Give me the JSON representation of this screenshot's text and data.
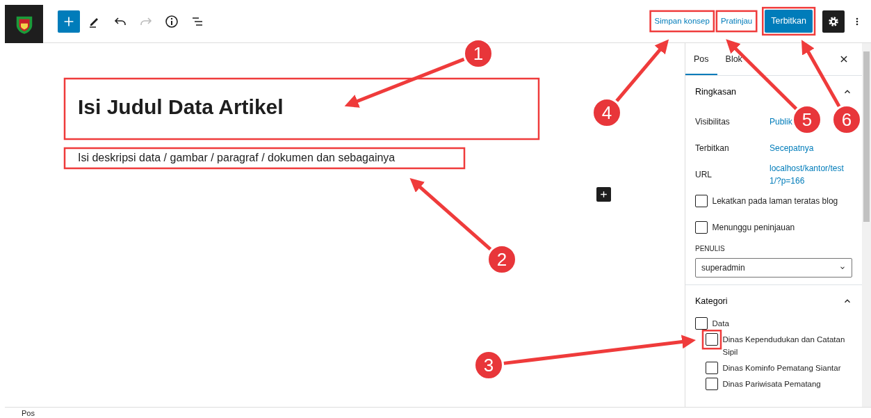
{
  "toolbar": {
    "left_tools": [
      {
        "kind": "add",
        "disabled": false
      },
      {
        "kind": "edit",
        "disabled": false
      },
      {
        "kind": "undo",
        "disabled": false
      },
      {
        "kind": "redo",
        "disabled": true
      },
      {
        "kind": "info",
        "disabled": false
      },
      {
        "kind": "list",
        "disabled": false
      }
    ],
    "save_draft": "Simpan konsep",
    "preview": "Pratinjau",
    "publish": "Terbitkan",
    "settings_pressed": true
  },
  "editor": {
    "title": "Isi Judul Data Artikel",
    "paragraph": "Isi deskripsi data / gambar / paragraf / dokumen dan sebagainya"
  },
  "sidebar": {
    "tabs": [
      {
        "label": "Pos",
        "selected": true
      },
      {
        "label": "Blok",
        "selected": false
      }
    ],
    "summary": {
      "title": "Ringkasan",
      "expanded": true,
      "rows": [
        {
          "label": "Visibilitas",
          "value": "Publik"
        },
        {
          "label": "Terbitkan",
          "value": "Secepatnya"
        },
        {
          "label": "URL",
          "value": "localhost/kantor/test 1/?p=166"
        }
      ],
      "options": [
        {
          "label": "Lekatkan pada laman teratas blog",
          "checked": false
        },
        {
          "label": "Menunggu peninjauan",
          "checked": false
        }
      ],
      "author_label": "PENULIS",
      "author": "superadmin"
    },
    "categories": {
      "title": "Kategori",
      "expanded": true,
      "items": [
        {
          "label": "Data",
          "checked": false,
          "children": [
            {
              "label": "Dinas Kependudukan dan Catatan Sipil",
              "checked": false
            },
            {
              "label": "Dinas Kominfo Pematang Siantar",
              "checked": false
            },
            {
              "label": "Dinas Pariwisata Pematang",
              "checked": false
            }
          ]
        }
      ]
    }
  },
  "annotations": [
    {
      "label": "1"
    },
    {
      "label": "2"
    },
    {
      "label": "3"
    },
    {
      "label": "4"
    },
    {
      "label": "5"
    },
    {
      "label": "6"
    }
  ],
  "status_bar": "Pos"
}
